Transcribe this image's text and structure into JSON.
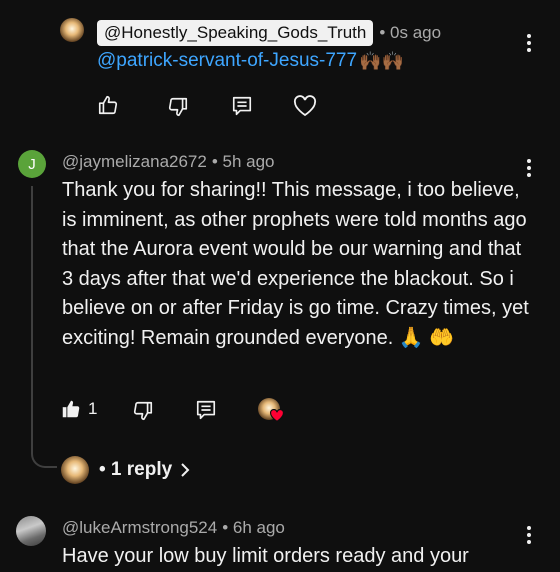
{
  "comment1": {
    "author": "@Honestly_Speaking_Gods_Truth",
    "time": "• 0s ago",
    "mention": "@patrick-servant-of-Jesus-777",
    "emoji": "🙌🏾🙌🏾",
    "icons": [
      "thumb-up-icon",
      "thumb-down-icon",
      "reply-icon",
      "heart-icon",
      "more-vert-icon"
    ]
  },
  "comment2": {
    "avatar_letter": "J",
    "avatar_color": "#5aa33a",
    "author": "@jaymelizana2672",
    "time": "• 5h ago",
    "text": "Thank you for sharing!! This message, i too believe, is imminent, as other prophets were told months ago that the Aurora event would be our warning and that 3 days after that we'd experience the blackout. So i believe on or after Friday is go time. Crazy times, yet exciting! Remain grounded everyone. 🙏 🤲",
    "like_count": "1",
    "replies_label": "• 1 reply",
    "icons": [
      "thumb-up-filled-icon",
      "thumb-down-icon",
      "reply-icon",
      "creator-heart-icon",
      "chevron-right-icon",
      "more-vert-icon"
    ]
  },
  "comment3": {
    "author": "@lukeArmstrong524",
    "time": "• 6h ago",
    "text": "Have your low buy limit orders ready and your"
  },
  "colors": {
    "background": "#0f0f0f",
    "text": "#f1f1f1",
    "muted": "#aaaaaa",
    "link": "#3ea6ff",
    "heart": "#ff0033"
  }
}
